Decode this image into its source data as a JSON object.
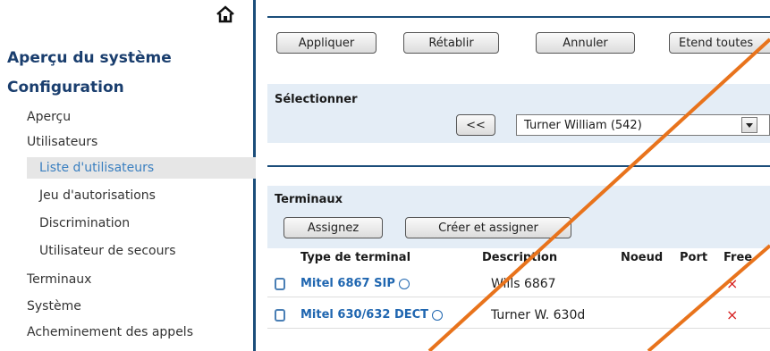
{
  "sidebar": {
    "home_icon": "home-icon",
    "system_overview": "Aperçu du système",
    "configuration": "Configuration",
    "items": [
      {
        "label": "Aperçu",
        "level": 1
      },
      {
        "label": "Utilisateurs",
        "level": 1
      },
      {
        "label": "Liste d'utilisateurs",
        "level": 2,
        "active": true
      },
      {
        "label": "Jeu d'autorisations",
        "level": 2
      },
      {
        "label": "Discrimination",
        "level": 2
      },
      {
        "label": "Utilisateur de secours",
        "level": 2
      },
      {
        "label": "Terminaux",
        "level": 1
      },
      {
        "label": "Système",
        "level": 1
      },
      {
        "label": "Acheminement des appels",
        "level": 1
      }
    ]
  },
  "toolbar": {
    "apply": "Appliquer",
    "reset": "Rétablir",
    "cancel": "Annuler",
    "extend": "Etend toutes"
  },
  "select_section": {
    "title": "Sélectionner",
    "prev_button": "<<",
    "selected_user": "Turner William (542)"
  },
  "terminals": {
    "title": "Terminaux",
    "assign": "Assignez",
    "create_assign": "Créer et assigner",
    "columns": [
      "Type de terminal",
      "Description",
      "Noeud",
      "Port",
      "Free"
    ],
    "rows": [
      {
        "type": "Mitel 6867 SIP",
        "description": "Wills 6867",
        "free": "×"
      },
      {
        "type": "Mitel 630/632 DECT",
        "description": "Turner W. 630d",
        "free": "×"
      }
    ]
  },
  "colors": {
    "accent": "#1b4d7a",
    "link": "#1f66b0",
    "section_bg": "#e4edf6",
    "annotation": "#e8731c",
    "status_x": "#d62020"
  }
}
